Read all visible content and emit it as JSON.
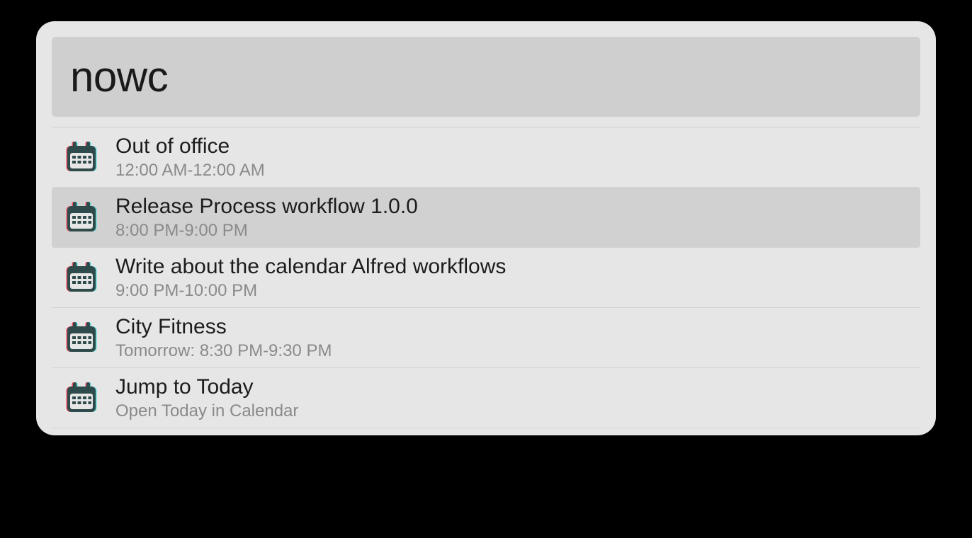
{
  "search": {
    "value": "nowc",
    "placeholder": ""
  },
  "results": [
    {
      "icon": "calendar-icon",
      "title": "Out of office",
      "subtitle": "12:00 AM-12:00 AM",
      "selected": false
    },
    {
      "icon": "calendar-icon",
      "title": "Release Process workflow 1.0.0",
      "subtitle": "8:00 PM-9:00 PM",
      "selected": true
    },
    {
      "icon": "calendar-icon",
      "title": "Write about the calendar Alfred workflows",
      "subtitle": "9:00 PM-10:00 PM",
      "selected": false
    },
    {
      "icon": "calendar-icon",
      "title": "City Fitness",
      "subtitle": "Tomorrow: 8:30 PM-9:30 PM",
      "selected": false
    },
    {
      "icon": "calendar-icon",
      "title": "Jump to Today",
      "subtitle": "Open Today in Calendar",
      "selected": false
    }
  ],
  "colors": {
    "iconRed": "#e84a5f",
    "iconCyan": "#5fd6d6",
    "iconDark": "#2f4a4a"
  }
}
